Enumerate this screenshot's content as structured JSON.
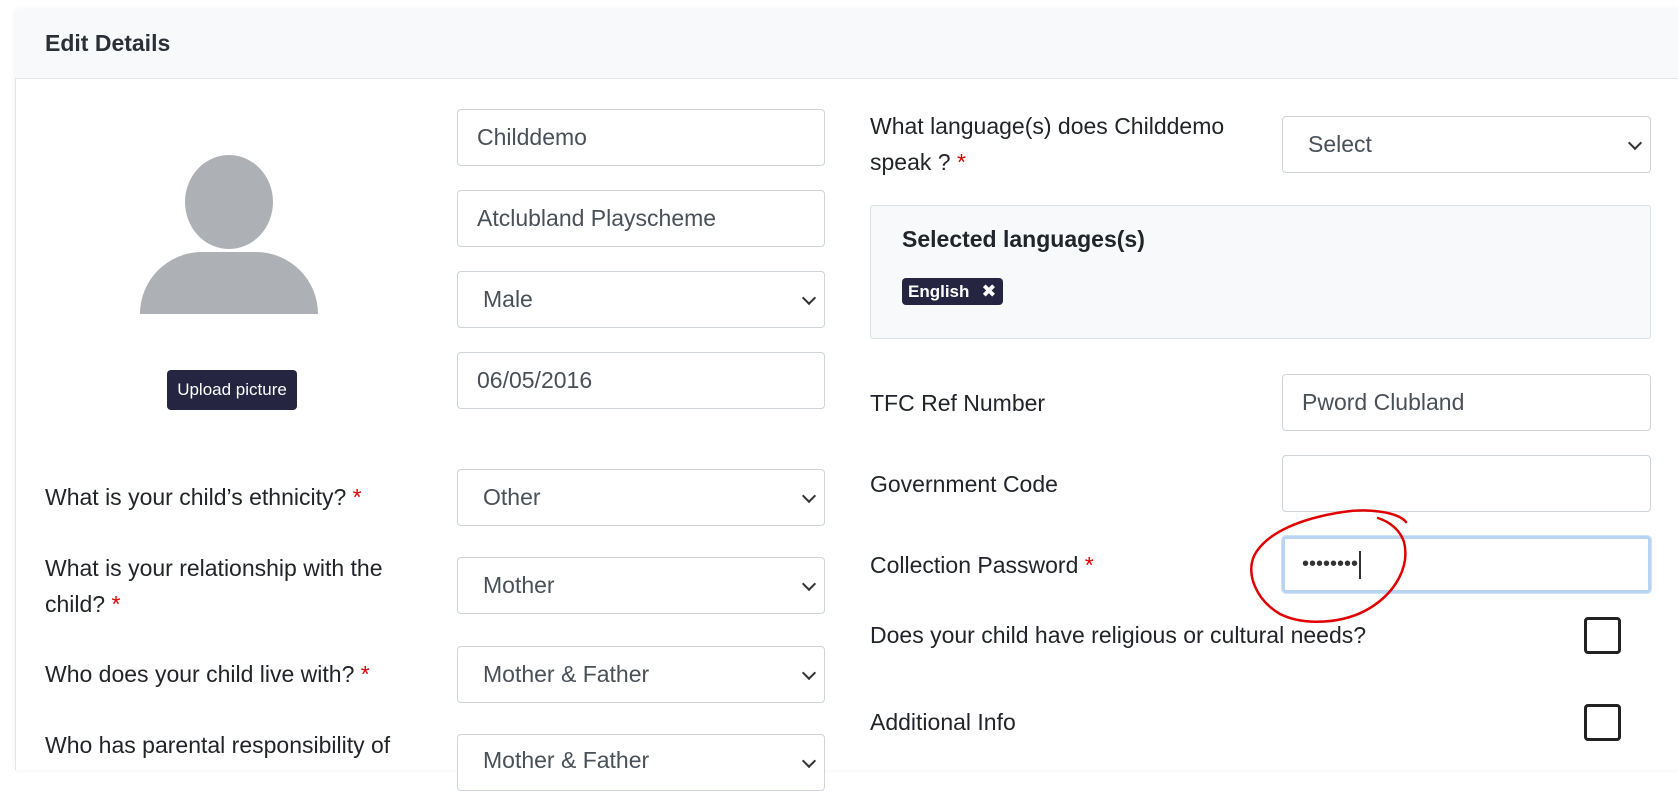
{
  "page": {
    "title": "Edit Details"
  },
  "avatar": {
    "upload_label": "Upload picture"
  },
  "left_fields": {
    "first_name": "Childdemo",
    "last_name": "Atclubland Playscheme",
    "gender": "Male",
    "dob": "06/05/2016"
  },
  "left_questions": {
    "ethnicity": {
      "label": "What is your child’s ethnicity?",
      "value": "Other"
    },
    "relationship": {
      "label_line1": "What is your relationship with the",
      "label_line2": "child?",
      "value": "Mother"
    },
    "lives_with": {
      "label": "Who does your child live with?",
      "value": "Mother & Father"
    },
    "parental_responsibility": {
      "label": "Who has parental responsibility of",
      "value": "Mother & Father"
    }
  },
  "right": {
    "language_question_line1": "What language(s) does Childdemo",
    "language_question_line2": "speak ?",
    "language_select": "Select",
    "selected_languages_title": "Selected languages(s)",
    "selected_languages": [
      "English"
    ],
    "tag_remove_icon": "✖",
    "tfc_label": "TFC Ref Number",
    "tfc_value": "Pword Clubland",
    "gov_label": "Government Code",
    "gov_value": "",
    "password_label": "Collection Password",
    "password_value": "••••••••",
    "religious_label": "Does your child have religious or cultural needs?",
    "additional_label": "Additional Info"
  },
  "required_marker": "*",
  "colors": {
    "primary_button": "#252541",
    "required": "#e00000",
    "annotation": "#e00000",
    "focus_border": "#b8d4f2"
  }
}
